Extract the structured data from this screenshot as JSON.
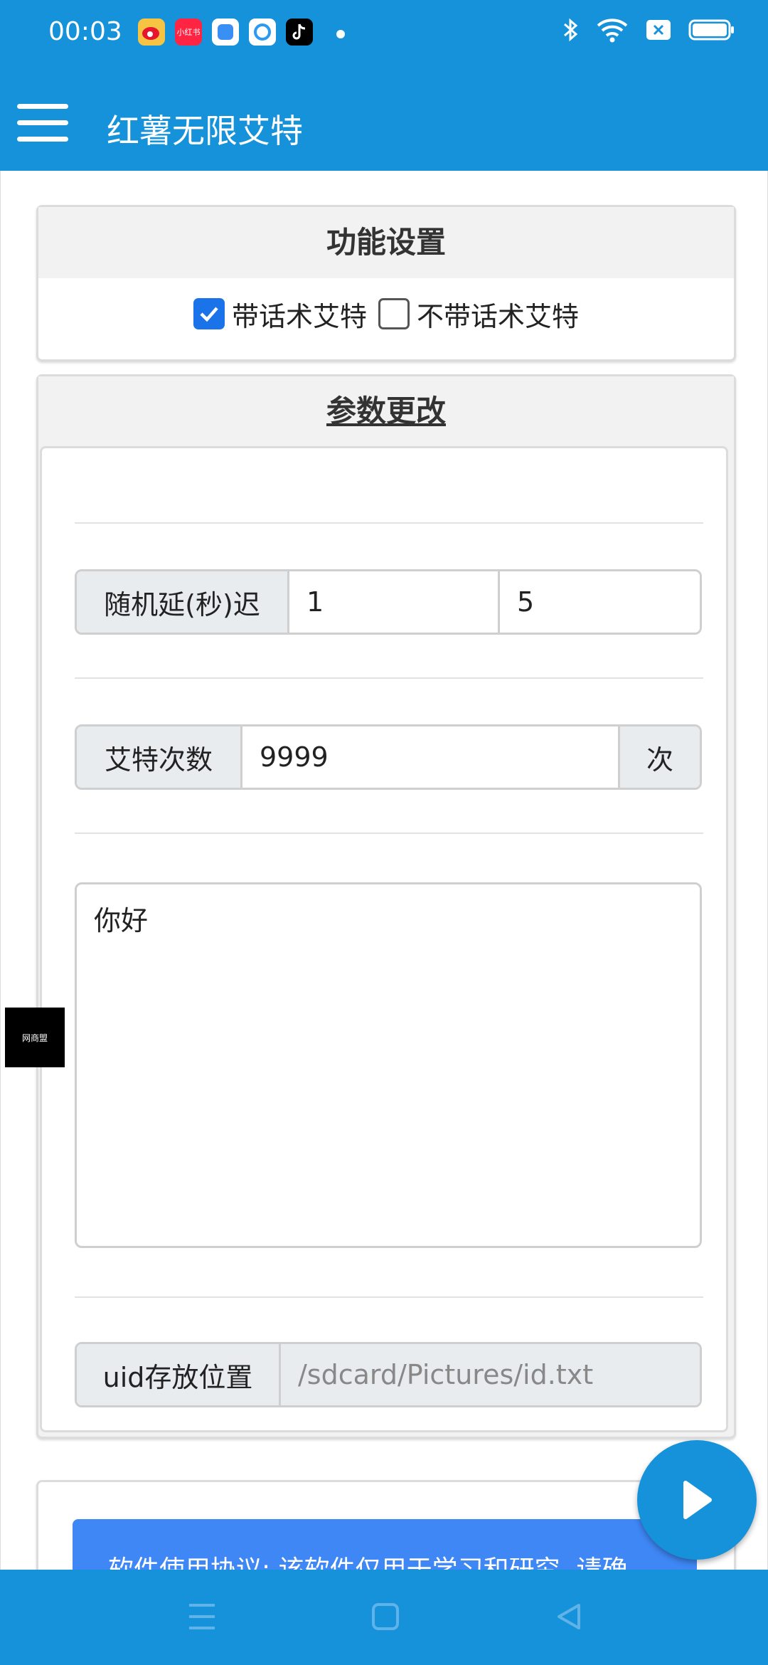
{
  "status_bar": {
    "time": "00:03",
    "notification_icons": [
      "weibo-icon",
      "xiaohongshu-icon",
      "app-icon",
      "browser-icon",
      "tiktok-icon"
    ],
    "xiaohongshu_text": "小红书",
    "system_icons": [
      "bluetooth-icon",
      "wifi-icon",
      "sim-icon",
      "battery-icon"
    ]
  },
  "app_bar": {
    "title": "红薯无限艾特"
  },
  "function_settings": {
    "title": "功能设置",
    "options": [
      {
        "label": "带话术艾特",
        "checked": true
      },
      {
        "label": "不带话术艾特",
        "checked": false
      }
    ]
  },
  "params": {
    "title": "参数更改",
    "random_delay": {
      "label": "随机延(秒)迟",
      "min": "1",
      "max": "5"
    },
    "at_count": {
      "label": "艾特次数",
      "value": "9999",
      "suffix": "次"
    },
    "message_text": "你好",
    "uid_path": {
      "label": "uid存放位置",
      "placeholder": "/sdcard/Pictures/id.txt"
    }
  },
  "agreement": {
    "text": "软件使用协议: 该软件仅用于学习和研究, 请确"
  },
  "floating_logo_text": "网商盟",
  "colors": {
    "primary": "#1592d9",
    "checkbox": "#1a73e8",
    "notice": "#3e87f5"
  }
}
